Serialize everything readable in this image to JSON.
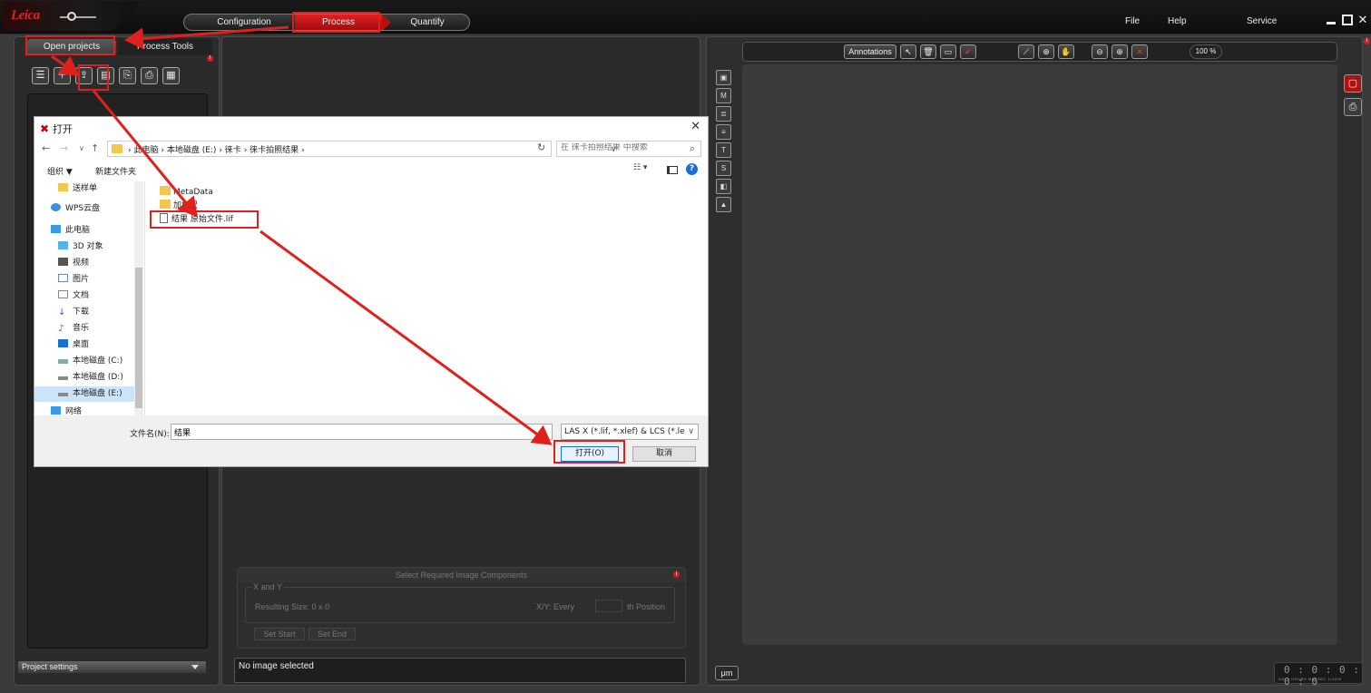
{
  "brand": "Leica",
  "workflow": {
    "configuration": "Configuration",
    "process": "Process",
    "quantify": "Quantify"
  },
  "menu": {
    "file": "File",
    "help": "Help",
    "service": "Service"
  },
  "left_panel": {
    "tab_open": "Open projects",
    "tab_process": "Process Tools",
    "toolbar_icons": [
      "new-project-icon",
      "add-file-icon",
      "open-project-icon",
      "save-icon",
      "import-icon",
      "export-icon",
      "grid-icon"
    ],
    "project_settings": "Project settings"
  },
  "components": {
    "header": "Select Required Image Components",
    "group_title": "X and Y",
    "resulting_size": "Resulting Size: 0 x 0",
    "every": "X/Y: Every",
    "position": "th Position",
    "set_start": "Set Start",
    "set_end": "Set End"
  },
  "status": "No image selected",
  "view_toolbar": {
    "annotations": "Annotations",
    "zoom": "100 %"
  },
  "um_button": "μm",
  "timer": {
    "digits": "0 : 0 : 0 : 0 : 0",
    "labels": "DAYS HOURS MIN SEC 1/1000"
  },
  "dialog": {
    "title": "打开",
    "path": [
      "此电脑",
      "本地磁盘 (E:)",
      "徕卡",
      "徕卡拍照结果"
    ],
    "search_placeholder": "在 徕卡拍照结果 中搜索",
    "organize": "组织 ▼",
    "new_folder": "新建文件夹",
    "nav_items": [
      "送样单",
      "WPS云盘",
      "此电脑",
      "3D 对象",
      "视频",
      "图片",
      "文档",
      "下载",
      "音乐",
      "桌面",
      "本地磁盘 (C:)",
      "本地磁盘 (D:)",
      "本地磁盘 (E:)",
      "网络"
    ],
    "nav_selected": "本地磁盘 (E:)",
    "files": [
      {
        "name": "MetaData",
        "type": "folder"
      },
      {
        "name": "加标尺",
        "type": "folder"
      },
      {
        "name": "结果 原始文件.lif",
        "type": "file"
      }
    ],
    "filename_label": "文件名(N):",
    "filename_value": "结果",
    "filetype": "LAS X (*.lif, *.xlef) & LCS (*.le",
    "open_button": "打开(O)",
    "cancel_button": "取消"
  },
  "colors": {
    "accent_red": "#e02222",
    "highlight_box": "#e0201c",
    "dialog_bg": "#ffffff",
    "app_bg": "#2b2b2b"
  }
}
